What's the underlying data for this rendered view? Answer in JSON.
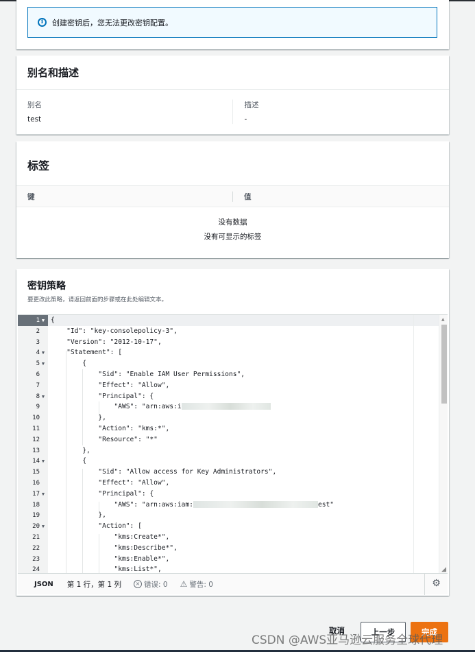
{
  "info": {
    "icon": "info-icon",
    "text": "创建密钥后，您无法更改密钥配置。"
  },
  "alias_section": {
    "title": "别名和描述",
    "alias_label": "别名",
    "alias_value": "test",
    "desc_label": "描述",
    "desc_value": "-"
  },
  "tags_section": {
    "title": "标签",
    "col_key": "键",
    "col_value": "值",
    "empty_title": "没有数据",
    "empty_sub": "没有可显示的标签"
  },
  "policy_section": {
    "title": "密钥策略",
    "description": "要更改此策略，请返回前面的步骤或在此处编辑文本。",
    "line_numbers": [
      "1",
      "2",
      "3",
      "4",
      "5",
      "6",
      "7",
      "8",
      "9",
      "10",
      "11",
      "12",
      "13",
      "14",
      "15",
      "16",
      "17",
      "18",
      "19",
      "20",
      "21",
      "22",
      "23",
      "24"
    ],
    "lines": [
      "{",
      "    \"Id\": \"key-consolepolicy-3\",",
      "    \"Version\": \"2012-10-17\",",
      "    \"Statement\": [",
      "        {",
      "            \"Sid\": \"Enable IAM User Permissions\",",
      "            \"Effect\": \"Allow\",",
      "            \"Principal\": {",
      "                \"AWS\": \"arn:aws:i",
      "            },",
      "            \"Action\": \"kms:*\",",
      "            \"Resource\": \"*\"",
      "        },",
      "        {",
      "            \"Sid\": \"Allow access for Key Administrators\",",
      "            \"Effect\": \"Allow\",",
      "            \"Principal\": {",
      "                \"AWS\": \"arn:aws:iam:",
      "            },",
      "            \"Action\": [",
      "                \"kms:Create*\",",
      "                \"kms:Describe*\",",
      "                \"kms:Enable*\",",
      "                \"kms:List*\","
    ],
    "line18_suffix": "est\"",
    "status": {
      "mode": "JSON",
      "position": "第 1 行，第 1 列",
      "errors": "错误: 0",
      "warnings": "警告: 0"
    }
  },
  "footer": {
    "cancel": "取消",
    "previous": "上一步",
    "finish": "完成"
  },
  "watermark": "CSDN @AWS亚马逊云服务全球代理",
  "colors": {
    "info_border": "#0073bb",
    "primary_button": "#ec7211"
  }
}
